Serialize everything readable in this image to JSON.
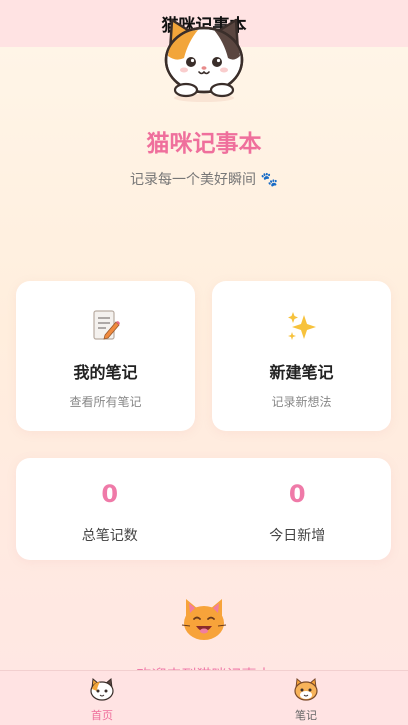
{
  "header": {
    "title": "猫咪记事本"
  },
  "hero": {
    "app_title": "猫咪记事本",
    "subtitle": "记录每一个美好瞬间 🐾"
  },
  "cards": [
    {
      "icon": "memo-icon",
      "title": "我的笔记",
      "subtitle": "查看所有笔记"
    },
    {
      "icon": "sparkles-icon",
      "title": "新建笔记",
      "subtitle": "记录新想法"
    }
  ],
  "stats": [
    {
      "value": "0",
      "label": "总笔记数"
    },
    {
      "value": "0",
      "label": "今日新增"
    }
  ],
  "welcome": "欢迎来到猫咪记事本",
  "tabbar": {
    "tabs": [
      {
        "label": "首页",
        "active": true,
        "icon": "calico-cat-icon"
      },
      {
        "label": "笔记",
        "active": false,
        "icon": "orange-cat-icon"
      }
    ]
  },
  "colors": {
    "accent": "#ef6f9c",
    "number": "#ef7aa8",
    "bar": "#ffe3e3"
  }
}
